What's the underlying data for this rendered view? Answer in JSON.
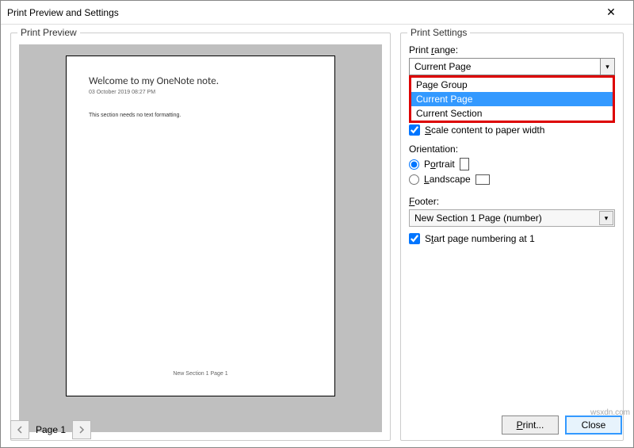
{
  "dialog": {
    "title": "Print Preview and Settings"
  },
  "preview": {
    "group_label": "Print Preview",
    "page_label": "Page 1",
    "paper": {
      "title": "Welcome to my OneNote note.",
      "meta": "03 October 2019    08:27 PM",
      "body": "This section needs no text formatting.",
      "footer": "New Section 1 Page 1"
    }
  },
  "settings": {
    "group_label": "Print Settings",
    "range_label": "Print range:",
    "range_value": "Current Page",
    "range_options": [
      "Page Group",
      "Current Page",
      "Current Section"
    ],
    "scale_label": "Scale content to paper width",
    "scale_checked": true,
    "orientation_label": "Orientation:",
    "portrait_label": "Portrait",
    "landscape_label": "Landscape",
    "orientation_value": "Portrait",
    "footer_label": "Footer:",
    "footer_value": "New Section 1 Page (number)",
    "startnum_label": "Start page numbering at 1",
    "startnum_checked": true
  },
  "buttons": {
    "print": "Print...",
    "close": "Close"
  },
  "watermark": "wsxdn.com"
}
